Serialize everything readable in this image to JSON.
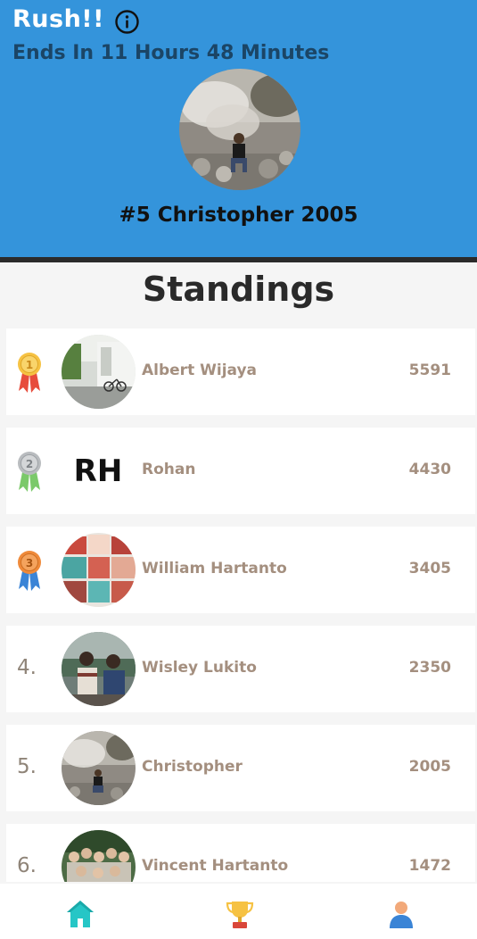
{
  "header": {
    "title": "Rush!!",
    "countdown": "Ends In 11 Hours 48 Minutes",
    "current_user_rank": "#5",
    "current_user_name": "Christopher",
    "current_user_score": "2005",
    "background_color": "#3494db"
  },
  "standings": {
    "title": "Standings",
    "entries": [
      {
        "rank": "1",
        "name": "Albert Wijaya",
        "score": "5591",
        "medal": "gold"
      },
      {
        "rank": "2",
        "name": "Rohan",
        "score": "4430",
        "medal": "silver",
        "avatar_text": "RH"
      },
      {
        "rank": "3",
        "name": "William Hartanto",
        "score": "3405",
        "medal": "bronze"
      },
      {
        "rank": "4.",
        "name": "Wisley Lukito",
        "score": "2350"
      },
      {
        "rank": "5.",
        "name": "Christopher",
        "score": "2005"
      },
      {
        "rank": "6.",
        "name": "Vincent Hartanto",
        "score": "1472"
      }
    ]
  },
  "nav": {
    "items": [
      {
        "icon": "home-icon"
      },
      {
        "icon": "trophy-icon"
      },
      {
        "icon": "user-icon"
      }
    ]
  }
}
